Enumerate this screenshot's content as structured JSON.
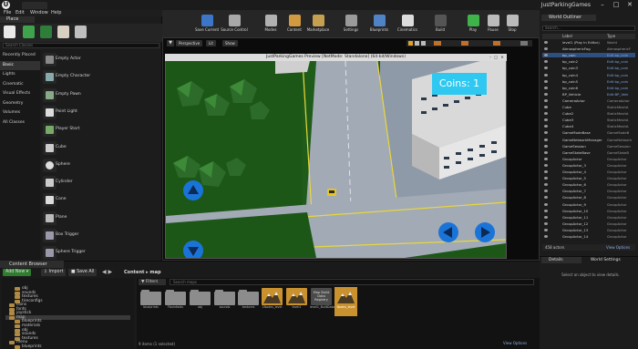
{
  "window": {
    "project_title": "JustParkingGames"
  },
  "menu": [
    "File",
    "Edit",
    "Window",
    "Help"
  ],
  "modes": {
    "tab_label": "Place",
    "search_placeholder": "Search Classes",
    "categories": [
      {
        "label": "Recently Placed",
        "active": false
      },
      {
        "label": "Basic",
        "active": true
      },
      {
        "label": "Lights",
        "active": false
      },
      {
        "label": "Cinematic",
        "active": false
      },
      {
        "label": "Visual Effects",
        "active": false
      },
      {
        "label": "Geometry",
        "active": false
      },
      {
        "label": "Volumes",
        "active": false
      },
      {
        "label": "All Classes",
        "active": false
      }
    ],
    "actors": [
      "Empty Actor",
      "Empty Character",
      "Empty Pawn",
      "Point Light",
      "Player Start",
      "Cube",
      "Sphere",
      "Cylinder",
      "Cone",
      "Plane",
      "Box Trigger",
      "Sphere Trigger"
    ]
  },
  "toolbar": {
    "buttons": [
      {
        "label": "Save Current",
        "icon": "save-icon"
      },
      {
        "label": "Source Control",
        "icon": "source-control-icon"
      },
      {
        "label": "Modes",
        "icon": "modes-icon"
      },
      {
        "label": "Content",
        "icon": "content-icon"
      },
      {
        "label": "Marketplace",
        "icon": "marketplace-icon"
      },
      {
        "label": "Settings",
        "icon": "settings-icon"
      },
      {
        "label": "Blueprints",
        "icon": "blueprints-icon"
      },
      {
        "label": "Cinematics",
        "icon": "cinematics-icon"
      },
      {
        "label": "Build",
        "icon": "build-icon"
      },
      {
        "label": "Play",
        "icon": "play-icon"
      },
      {
        "label": "Pause",
        "icon": "pause-icon"
      },
      {
        "label": "Stop",
        "icon": "stop-icon"
      }
    ]
  },
  "viewport": {
    "buttons": [
      "Perspective",
      "Lit",
      "Show"
    ]
  },
  "pie": {
    "title": "JustParkingGames Preview [NetMode: Standalone] (64-bit/Windows)",
    "hud_coins": "Coins: 1"
  },
  "outliner": {
    "tab_label": "World Outliner",
    "search_placeholder": "Search...",
    "col_label": "Label",
    "col_type": "Type",
    "rows": [
      {
        "name": "level1 (Play In Editor)",
        "type": "World",
        "link": false,
        "sel": false
      },
      {
        "name": "AtmosphericFog",
        "type": "AtmosphericF",
        "link": false,
        "sel": false
      },
      {
        "name": "bp_coin",
        "type": "Edit bp_coin",
        "link": true,
        "sel": true
      },
      {
        "name": "bp_coin2",
        "type": "Edit bp_coin",
        "link": true,
        "sel": false
      },
      {
        "name": "bp_coin3",
        "type": "Edit bp_coin",
        "link": true,
        "sel": false
      },
      {
        "name": "bp_coin4",
        "type": "Edit bp_coin",
        "link": true,
        "sel": false
      },
      {
        "name": "bp_coin5",
        "type": "Edit bp_coin",
        "link": true,
        "sel": false
      },
      {
        "name": "bp_coin6",
        "type": "Edit bp_coin",
        "link": true,
        "sel": false
      },
      {
        "name": "BP_Vehicle",
        "type": "Edit BP_Vehi",
        "link": true,
        "sel": false
      },
      {
        "name": "CameraActor",
        "type": "CameraActor",
        "link": false,
        "sel": false
      },
      {
        "name": "Cube",
        "type": "StaticMeshA",
        "link": false,
        "sel": false
      },
      {
        "name": "Cube2",
        "type": "StaticMeshA",
        "link": false,
        "sel": false
      },
      {
        "name": "Cube3",
        "type": "StaticMeshA",
        "link": false,
        "sel": false
      },
      {
        "name": "Cube4",
        "type": "StaticMeshA",
        "link": false,
        "sel": false
      },
      {
        "name": "GameModeBase",
        "type": "GameModeB",
        "link": false,
        "sel": false
      },
      {
        "name": "GameNetworkManager",
        "type": "GameNetwork",
        "link": false,
        "sel": false
      },
      {
        "name": "GameSession",
        "type": "GameSession",
        "link": false,
        "sel": false
      },
      {
        "name": "GameStateBase",
        "type": "GameStateB",
        "link": false,
        "sel": false
      },
      {
        "name": "GroupActor",
        "type": "GroupActor",
        "link": false,
        "sel": false
      },
      {
        "name": "GroupActor_3",
        "type": "GroupActor",
        "link": false,
        "sel": false
      },
      {
        "name": "GroupActor_4",
        "type": "GroupActor",
        "link": false,
        "sel": false
      },
      {
        "name": "GroupActor_5",
        "type": "GroupActor",
        "link": false,
        "sel": false
      },
      {
        "name": "GroupActor_6",
        "type": "GroupActor",
        "link": false,
        "sel": false
      },
      {
        "name": "GroupActor_7",
        "type": "GroupActor",
        "link": false,
        "sel": false
      },
      {
        "name": "GroupActor_8",
        "type": "GroupActor",
        "link": false,
        "sel": false
      },
      {
        "name": "GroupActor_9",
        "type": "GroupActor",
        "link": false,
        "sel": false
      },
      {
        "name": "GroupActor_10",
        "type": "GroupActor",
        "link": false,
        "sel": false
      },
      {
        "name": "GroupActor_11",
        "type": "GroupActor",
        "link": false,
        "sel": false
      },
      {
        "name": "GroupActor_12",
        "type": "GroupActor",
        "link": false,
        "sel": false
      },
      {
        "name": "GroupActor_13",
        "type": "GroupActor",
        "link": false,
        "sel": false
      },
      {
        "name": "GroupActor_14",
        "type": "GroupActor",
        "link": false,
        "sel": false
      }
    ],
    "footer_count": "458 actors",
    "view_options": "View Options"
  },
  "details": {
    "tab_label": "Details",
    "tab2_label": "World Settings",
    "empty_text": "Select an object to view details."
  },
  "content_browser": {
    "tab_label": "Content Browser",
    "add_new": "Add New",
    "import": "Import",
    "save_all": "Save All",
    "path_root": "Content",
    "path_current": "map",
    "search_paths_placeholder": "Search Paths",
    "filters_label": "Filters",
    "search_placeholder": "Search maps",
    "tree": [
      {
        "name": "obj",
        "depth": 1,
        "sel": false
      },
      {
        "name": "sounds",
        "depth": 1,
        "sel": false
      },
      {
        "name": "textures",
        "depth": 1,
        "sel": false
      },
      {
        "name": "tireconfigs",
        "depth": 1,
        "sel": false
      },
      {
        "name": "coins",
        "depth": 0,
        "sel": false
      },
      {
        "name": "fonts",
        "depth": 0,
        "sel": false
      },
      {
        "name": "joystick",
        "depth": 0,
        "sel": false
      },
      {
        "name": "map",
        "depth": 0,
        "sel": true
      },
      {
        "name": "blueprints",
        "depth": 1,
        "sel": false
      },
      {
        "name": "materials",
        "depth": 1,
        "sel": false
      },
      {
        "name": "obj",
        "depth": 1,
        "sel": false
      },
      {
        "name": "sounds",
        "depth": 1,
        "sel": false
      },
      {
        "name": "textures",
        "depth": 1,
        "sel": false
      },
      {
        "name": "menu",
        "depth": 0,
        "sel": false
      },
      {
        "name": "blueprints",
        "depth": 1,
        "sel": false
      }
    ],
    "assets": [
      {
        "name": "blueprints",
        "kind": "folder"
      },
      {
        "name": "Fbxinfolds",
        "kind": "folder"
      },
      {
        "name": "obj",
        "kind": "folder"
      },
      {
        "name": "sounds",
        "kind": "folder"
      },
      {
        "name": "textures",
        "kind": "folder"
      },
      {
        "name": "1Nodes_level",
        "kind": "level"
      },
      {
        "name": "level1",
        "kind": "level"
      },
      {
        "name": "level1_BuiltData",
        "kind": "data",
        "thumb_text": "Map Build Data Registry"
      },
      {
        "name": "Nodes_level",
        "kind": "level",
        "selected": true
      }
    ],
    "status": "9 items (1 selected)",
    "view_options": "View Options"
  },
  "colors": {
    "accent_blue": "#2f4f7f",
    "selection_orange": "#e08a1e",
    "hud_cyan": "#2ec8f0",
    "grass": "#1f5c1a",
    "road": "#9fa7b3",
    "road_line_yellow": "#e8d83a",
    "dpad_blue": "#1a74d8",
    "level_thumb": "#c9922e"
  }
}
